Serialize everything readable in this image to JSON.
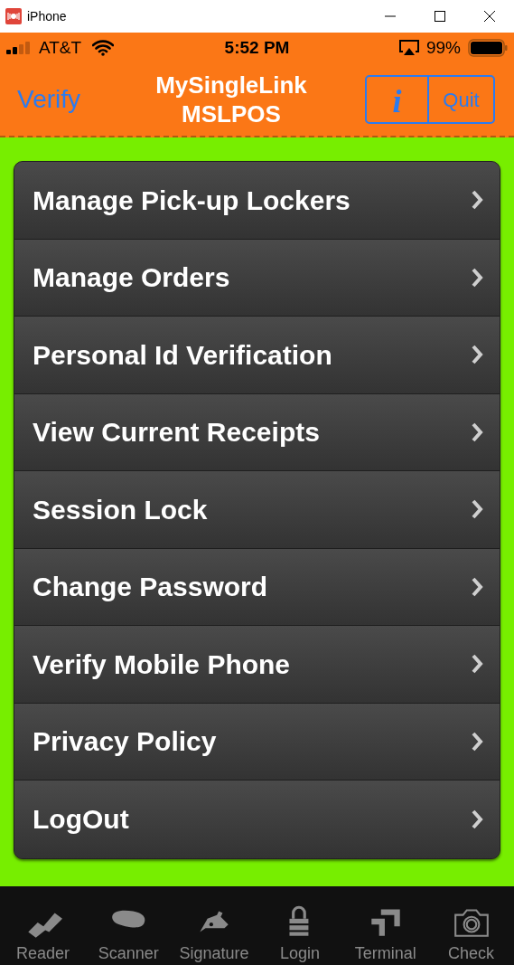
{
  "window": {
    "title": "iPhone"
  },
  "status_bar": {
    "carrier": "AT&T",
    "time": "5:52 PM",
    "battery": "99%"
  },
  "nav": {
    "left": "Verify",
    "title": "MySingleLink",
    "subtitle": "MSLPOS",
    "info": "i",
    "quit": "Quit"
  },
  "menu": [
    {
      "label": "Manage Pick-up Lockers"
    },
    {
      "label": "Manage Orders"
    },
    {
      "label": "Personal Id Verification"
    },
    {
      "label": "View Current Receipts"
    },
    {
      "label": "Session Lock"
    },
    {
      "label": "Change Password"
    },
    {
      "label": "Verify Mobile Phone"
    },
    {
      "label": "Privacy Policy"
    },
    {
      "label": "LogOut"
    }
  ],
  "tabs": [
    {
      "label": "Reader",
      "kind": "reader"
    },
    {
      "label": "Scanner",
      "kind": "scanner"
    },
    {
      "label": "Signature",
      "kind": "signature"
    },
    {
      "label": "Login",
      "kind": "login"
    },
    {
      "label": "Terminal",
      "kind": "terminal"
    },
    {
      "label": "Check",
      "kind": "camera"
    }
  ]
}
